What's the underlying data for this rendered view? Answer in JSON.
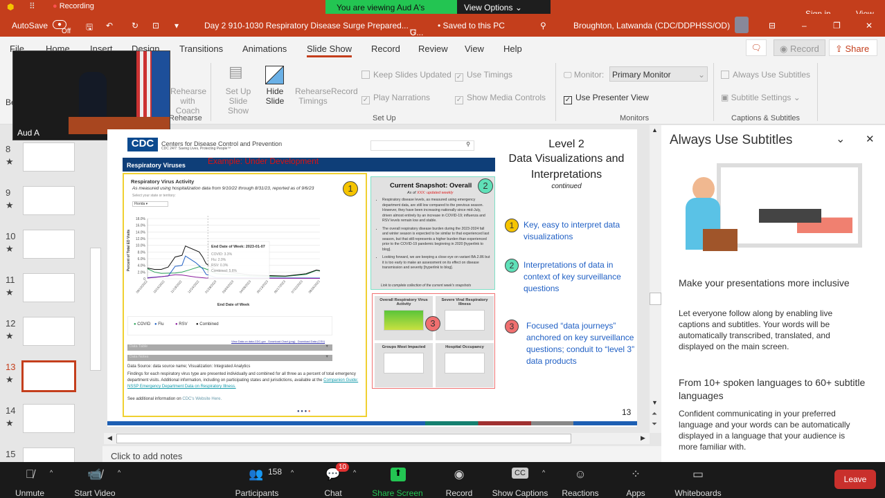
{
  "zoom_top": {
    "recording": "Recording",
    "banner": "You are viewing Aud A's screen",
    "view_options": "View Options",
    "sign_in": "Sign in",
    "view": "View"
  },
  "titlebar": {
    "autosave": "AutoSave",
    "autosave_state": "Off",
    "doc_title": "Day 2 910-1030 Respiratory Disease Surge Prepared...",
    "sensitivity": "G...",
    "save_state": "• Saved to this PC",
    "user": "Broughton, Latwanda (CDC/DDPHSS/OD)"
  },
  "tabs": [
    "File",
    "Home",
    "Insert",
    "Design",
    "Transitions",
    "Animations",
    "Slide Show",
    "Record",
    "Review",
    "View",
    "Help"
  ],
  "active_tab": "Slide Show",
  "ribbon_right": {
    "record": "Record",
    "share": "Share"
  },
  "ribbon": {
    "rehearse_coach": "Rehearse with Coach",
    "rehearse_group": "Rehearse",
    "setup_show": "Set Up Slide Show",
    "hide_slide": "Hide Slide",
    "rehearse_timings": "Rehearse Timings",
    "record": "Record",
    "keep_updated": "Keep Slides Updated",
    "use_timings": "Use Timings",
    "play_narrations": "Play Narrations",
    "show_media": "Show Media Controls",
    "setup_group": "Set Up",
    "monitor_label": "Monitor:",
    "monitor_value": "Primary Monitor",
    "presenter_view": "Use Presenter View",
    "monitors_group": "Monitors",
    "always_subtitles": "Always Use Subtitles",
    "subtitle_settings": "Subtitle Settings",
    "captions_group": "Captions & Subtitles",
    "be": "Be"
  },
  "video": {
    "name": "Aud A"
  },
  "thumbnails": [
    {
      "n": "8"
    },
    {
      "n": "9"
    },
    {
      "n": "10"
    },
    {
      "n": "11"
    },
    {
      "n": "12"
    },
    {
      "n": "13",
      "selected": true
    },
    {
      "n": "14"
    },
    {
      "n": "15"
    }
  ],
  "slide": {
    "number": "13",
    "cdc_logo": "CDC",
    "cdc_name": "Centers for Disease Control and Prevention",
    "cdc_tagline": "CDC 24/7: Saving Lives, Protecting People™",
    "nav": "Respiratory Viruses",
    "example": "Example: Under Development",
    "panel1": {
      "title": "Respiratory Virus Activity",
      "subtitle": "As measured using hospitalization data from 9/10/22 through 8/31/23, reported as of 9/6/23",
      "select_label": "Select your state or territory:",
      "select_value": "Florida",
      "badge": "1",
      "chart": {
        "type": "line",
        "ylabel": "Percent of Total ED Visits",
        "xlabel": "End Date of Week",
        "yticks": [
          "18.0%",
          "16.0%",
          "14.0%",
          "12.0%",
          "10.0%",
          "8.0%",
          "6.0%",
          "4.0%",
          "2.0%",
          "0"
        ],
        "ylim": [
          0,
          18
        ],
        "xticks": [
          "09/10/2022",
          "10/15/2022",
          "11/19/2022",
          "12/24/2022",
          "01/28/2023",
          "03/04/2023",
          "04/08/2023",
          "05/13/2023",
          "06/17/2023",
          "07/22/2023",
          "08/26/2023"
        ],
        "series": [
          {
            "name": "COVID",
            "color": "#2ca35a",
            "points": [
              [
                0,
                3.0
              ],
              [
                2,
                2.0
              ],
              [
                4,
                1.6
              ],
              [
                8,
                1.7
              ],
              [
                10,
                2.0
              ],
              [
                12,
                2.6
              ],
              [
                15,
                3.6
              ],
              [
                17,
                2.9
              ],
              [
                20,
                1.5
              ],
              [
                30,
                0.8
              ],
              [
                40,
                0.7
              ],
              [
                46,
                1.3
              ],
              [
                49,
                2.5
              ],
              [
                50,
                2.3
              ]
            ]
          },
          {
            "name": "Flu",
            "color": "#1f5fc4",
            "points": [
              [
                0,
                0.3
              ],
              [
                6,
                0.8
              ],
              [
                8,
                3.7
              ],
              [
                10,
                4.0
              ],
              [
                11,
                6.8
              ],
              [
                14,
                4.8
              ],
              [
                16,
                3.0
              ],
              [
                17,
                1.3
              ],
              [
                20,
                0.3
              ],
              [
                50,
                0.2
              ]
            ]
          },
          {
            "name": "RSV",
            "color": "#8a1a9c",
            "points": [
              [
                0,
                0.2
              ],
              [
                4,
                0.6
              ],
              [
                8,
                1.2
              ],
              [
                10,
                1.1
              ],
              [
                14,
                0.5
              ],
              [
                17,
                0.2
              ],
              [
                50,
                0.1
              ]
            ]
          },
          {
            "name": "Combined",
            "color": "#111111",
            "points": [
              [
                0,
                3.2
              ],
              [
                2,
                2.8
              ],
              [
                4,
                2.8
              ],
              [
                6,
                3.5
              ],
              [
                8,
                6.5
              ],
              [
                10,
                7.0
              ],
              [
                11,
                9.8
              ],
              [
                15,
                8.0
              ],
              [
                16,
                6.5
              ],
              [
                17,
                4.5
              ],
              [
                20,
                2.5
              ],
              [
                30,
                1.1
              ],
              [
                40,
                0.8
              ],
              [
                46,
                1.5
              ],
              [
                49,
                2.6
              ],
              [
                50,
                2.4
              ]
            ]
          }
        ],
        "tooltip": {
          "title": "End Date of Week: 2023-01-07",
          "lines": [
            "COVID: 3.3%",
            "Flu: 2.0%",
            "RSV: 0.3%",
            "Combined: 5.6%"
          ]
        }
      },
      "links": [
        "View Data on data.CDC.gov",
        "Download Chart (png)",
        "Download Data (CSV)"
      ],
      "data_table": "Data Table",
      "data_notes": "Data Notes",
      "source": "Data Source: data source name; Visualization: Integrated Analytics",
      "findings": "Findings for each respiratory virus type are presented individually and combined for all three as a percent of total emergency department visits. Additional information, including on participating states and jurisdictions, available at the ",
      "guide_link": "Companion Guide: NSSP Emergency Department Data on Respiratory Illness.",
      "see_more": "See additional information on ",
      "cdc_link": "CDC's Website Here."
    },
    "panel2": {
      "title": "Current Snapshot: Overall",
      "as_of_prefix": "As of ",
      "as_of_red": "XXX: updated weekly",
      "badge": "2",
      "bullets": [
        "Respiratory disease levels, as measured using emergency department data, are still low compared to the previous season. However, they have been increasing nationally since mid-July, driven almost entirely by an increase in COVID-19; influenza and RSV levels remain low and stable.",
        "The overall respiratory disease burden during the 2023-2024 fall and winter season is expected to be similar to that experienced last season, but that still represents a higher burden than experienced prior to the COVID-19 pandemic beginning in 2020 [hyperlink to blog].",
        "Looking forward, we are keeping a close eye on variant BA.2.86 but it is too early to make an assessment on its effect on disease transmission and severity [hyperlink to blog]."
      ],
      "link": "Link to complete collection of the current week's snapshots"
    },
    "panel3": {
      "badge": "3",
      "tiles": [
        "Overall Respiratory Virus Activity",
        "Severe Viral Respiratory Illness",
        "Groups Most Impacted",
        "Hospital Occupancy"
      ]
    },
    "side": {
      "title": "Level 2",
      "title2": "Data Visualizations and Interpretations",
      "continued": "continued",
      "items": [
        {
          "n": "1",
          "text": "Key, easy to interpret data visualizations",
          "color": "#f5c400"
        },
        {
          "n": "2",
          "text": "Interpretations of data in context of key surveillance questions",
          "color": "#5fe0b8"
        },
        {
          "n": "3",
          "text": "Focused “data journeys” anchored on key surveillance questions; conduit to “level 3” data products",
          "color": "#f07070"
        }
      ]
    }
  },
  "notes_placeholder": "Click to add notes",
  "right_panel": {
    "title": "Always Use Subtitles",
    "h1": "Make your presentations more inclusive",
    "p1": "Let everyone follow along by enabling live captions and subtitles. Your words will be automatically transcribed, translated, and displayed on the main screen.",
    "h2": "From 10+ spoken languages to 60+ subtitle languages",
    "p2": "Confident communicating in your preferred language and your words can be automatically displayed in a language that your audience is more familiar with."
  },
  "zoom_bar": {
    "unmute": "Unmute",
    "start_video": "Start Video",
    "participants": "Participants",
    "participant_count": "158",
    "chat": "Chat",
    "chat_badge": "10",
    "share": "Share Screen",
    "record": "Record",
    "captions": "Show Captions",
    "reactions": "Reactions",
    "apps": "Apps",
    "whiteboards": "Whiteboards",
    "leave": "Leave"
  },
  "colors": {
    "accent": "#c43e1c",
    "zoom_green": "#23c552",
    "leave": "#c9302c"
  }
}
